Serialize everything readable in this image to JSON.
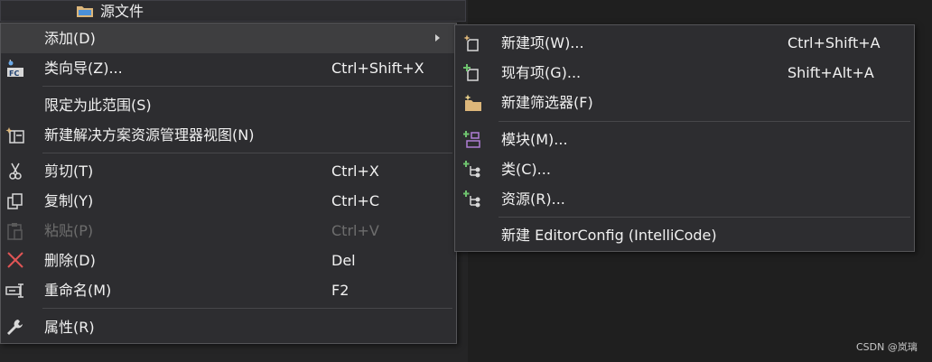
{
  "tree": {
    "partial_item": "源文件"
  },
  "context_menu": {
    "items": [
      {
        "label": "添加(D)",
        "shortcut": "",
        "icon": "none",
        "submenu": true,
        "highlighted": true
      },
      {
        "label": "类向导(Z)...",
        "shortcut": "Ctrl+Shift+X",
        "icon": "class-wizard-icon"
      },
      {
        "label": "限定为此范围(S)",
        "shortcut": "",
        "icon": "none"
      },
      {
        "label": "新建解决方案资源管理器视图(N)",
        "shortcut": "",
        "icon": "new-solution-view-icon"
      },
      {
        "label": "剪切(T)",
        "shortcut": "Ctrl+X",
        "icon": "scissors-icon"
      },
      {
        "label": "复制(Y)",
        "shortcut": "Ctrl+C",
        "icon": "copy-icon"
      },
      {
        "label": "粘贴(P)",
        "shortcut": "Ctrl+V",
        "icon": "paste-icon",
        "disabled": true
      },
      {
        "label": "删除(D)",
        "shortcut": "Del",
        "icon": "delete-x-icon"
      },
      {
        "label": "重命名(M)",
        "shortcut": "F2",
        "icon": "rename-icon"
      },
      {
        "label": "属性(R)",
        "shortcut": "",
        "icon": "wrench-icon"
      }
    ]
  },
  "submenu": {
    "items": [
      {
        "label": "新建项(W)...",
        "shortcut": "Ctrl+Shift+A",
        "icon": "new-item-icon"
      },
      {
        "label": "现有项(G)...",
        "shortcut": "Shift+Alt+A",
        "icon": "existing-item-icon"
      },
      {
        "label": "新建筛选器(F)",
        "shortcut": "",
        "icon": "new-filter-folder-icon"
      },
      {
        "label": "模块(M)...",
        "shortcut": "",
        "icon": "module-icon"
      },
      {
        "label": "类(C)...",
        "shortcut": "",
        "icon": "class-icon"
      },
      {
        "label": "资源(R)...",
        "shortcut": "",
        "icon": "resource-icon"
      },
      {
        "label": "新建 EditorConfig (IntelliCode)",
        "shortcut": "",
        "icon": "none"
      }
    ]
  },
  "colors": {
    "menu_bg": "#2d2d30",
    "highlight": "#3e3e40",
    "text": "#f1f1f1",
    "disabled_text": "#6d6d6d",
    "accent_green": "#6ec36e",
    "folder_yellow": "#dcb67a",
    "delete_red": "#e05555"
  },
  "watermark": "CSDN @岚璃"
}
